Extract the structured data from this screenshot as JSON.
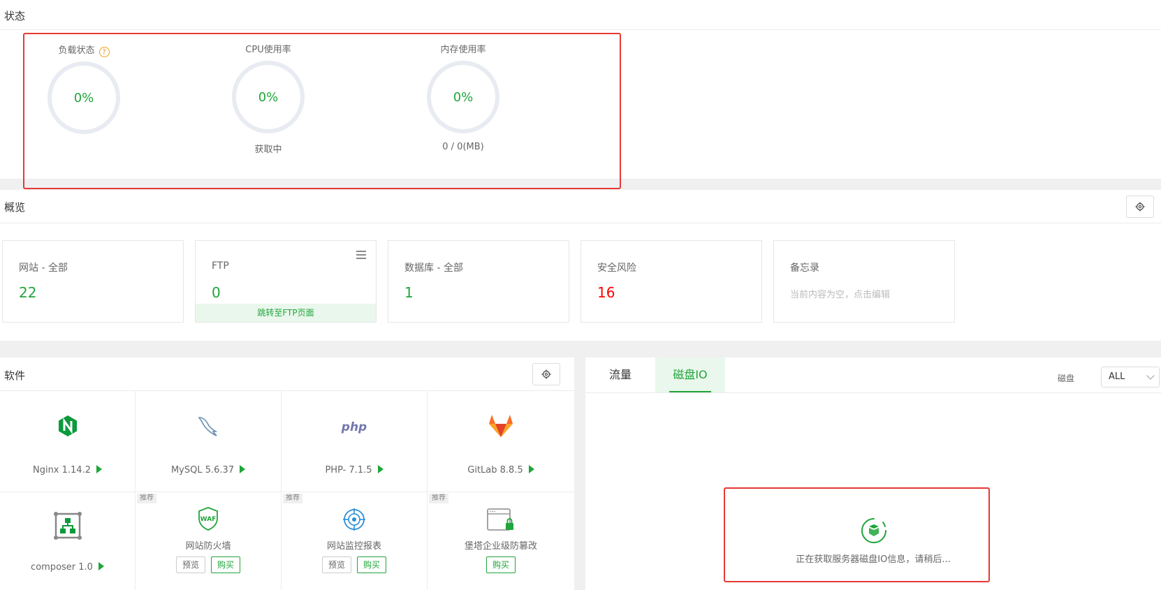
{
  "status": {
    "title": "状态",
    "gauges": [
      {
        "label": "负载状态",
        "value": "0%",
        "sub": ""
      },
      {
        "label": "CPU使用率",
        "value": "0%",
        "sub": "获取中"
      },
      {
        "label": "内存使用率",
        "value": "0%",
        "sub": "0 / 0(MB)"
      }
    ],
    "help_glyph": "?"
  },
  "overview": {
    "title": "概览",
    "cards": [
      {
        "label": "网站 - 全部",
        "value": "22"
      },
      {
        "label": "FTP",
        "value": "0",
        "link": "跳转至FTP页面"
      },
      {
        "label": "数据库 - 全部",
        "value": "1"
      },
      {
        "label": "安全风险",
        "value": "16"
      },
      {
        "label": "备忘录",
        "placeholder": "当前内容为空，点击编辑"
      }
    ]
  },
  "software": {
    "title": "软件",
    "items": [
      {
        "name": "Nginx 1.14.2"
      },
      {
        "name": "MySQL 5.6.37"
      },
      {
        "name": "PHP- 7.1.5"
      },
      {
        "name": "GitLab 8.8.5"
      },
      {
        "name": "composer 1.0"
      },
      {
        "name": "网站防火墙",
        "tag": "推荐",
        "preview": "预览",
        "buy": "购买"
      },
      {
        "name": "网站监控报表",
        "tag": "推荐",
        "preview": "预览",
        "buy": "购买"
      },
      {
        "name": "堡塔企业级防篡改",
        "tag": "推荐",
        "buy": "购买"
      }
    ],
    "php_logo_text": "php",
    "waf_logo_text": "WAF"
  },
  "io": {
    "tabs": [
      {
        "label": "流量",
        "active": false
      },
      {
        "label": "磁盘IO",
        "active": true
      }
    ],
    "disk_label": "磁盘",
    "disk_value": "ALL",
    "loading_text": "正在获取服务器磁盘IO信息，请稍后..."
  },
  "colors": {
    "accent": "#20a53a",
    "danger": "#ff0000",
    "highlight": "#e53935"
  }
}
